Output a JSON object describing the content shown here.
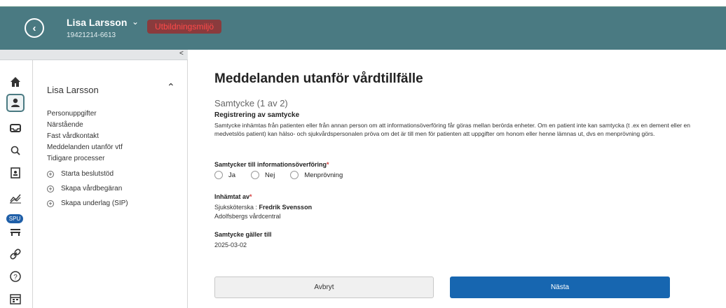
{
  "header": {
    "patient_name": "Lisa Larsson",
    "patient_id": "19421214-6613",
    "environment_badge": "Utbildningsmiljö",
    "back_icon": "chevron-left-circle-icon",
    "dropdown_icon": "chevron-down-icon"
  },
  "iconbar": {
    "items": [
      {
        "name": "home-icon"
      },
      {
        "name": "patient-icon"
      },
      {
        "name": "inbox-icon"
      },
      {
        "name": "search-icon"
      },
      {
        "name": "document-icon"
      },
      {
        "name": "chart-icon"
      },
      {
        "name": "bed-icon"
      },
      {
        "name": "link-icon"
      },
      {
        "name": "help-icon"
      },
      {
        "name": "calendar-icon"
      }
    ],
    "spu_badge": "SPU"
  },
  "sidepanel": {
    "collapse_label": "<",
    "title": "Lisa Larsson",
    "links": [
      "Personuppgifter",
      "Närstående",
      "Fast vårdkontakt",
      "Meddelanden utanför vtf",
      "Tidigare processer"
    ],
    "actions": [
      "Starta beslutstöd",
      "Skapa vårdbegäran",
      "Skapa underlag (SIP)"
    ]
  },
  "main": {
    "title": "Meddelanden utanför vårdtillfälle",
    "section": "Samtycke (1 av 2)",
    "subheading": "Registrering av samtycke",
    "info_text": "Samtycke inhämtas från patienten eller från annan person om att informationsöverföring får göras mellan berörda enheter. Om en patient inte kan samtycka (t .ex en dement eller en medvetslös patient) kan hälso- och sjukvårdspersonalen pröva om det är till men för patienten att uppgifter om honom eller henne lämnas ut, dvs en menprövning görs.",
    "question_label": "Samtycker till informationsöverföring",
    "options": [
      "Ja",
      "Nej",
      "Menprövning"
    ],
    "collected_by_label": "Inhämtat av",
    "collected_by_role": "Sjuksköterska : ",
    "collected_by_name": "Fredrik Svensson",
    "collected_by_unit": "Adolfsbergs vårdcentral",
    "valid_until_label": "Samtycke gäller till",
    "valid_until_date": "2025-03-02",
    "cancel_label": "Avbryt",
    "next_label": "Nästa"
  },
  "colors": {
    "header_bg": "#4a7a82",
    "badge_bg": "#8a3b3d",
    "badge_text": "#ff4a4a",
    "primary": "#1766b0",
    "required": "#d23a3a"
  }
}
